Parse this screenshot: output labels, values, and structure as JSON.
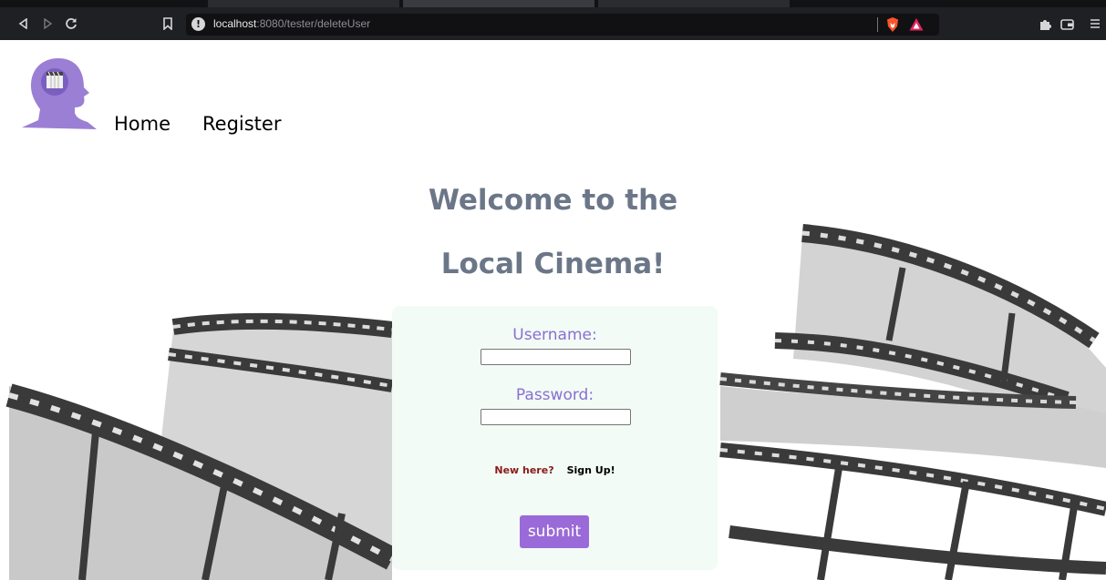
{
  "browser": {
    "url_host": "localhost",
    "url_rest": ":8080/tester/deleteUser",
    "back_icon": "back-arrow-icon",
    "forward_icon": "forward-arrow-icon",
    "reload_icon": "reload-icon",
    "bookmark_icon": "bookmark-icon",
    "info_icon": "info-icon",
    "brave_shield_icon": "brave-shield-icon",
    "brave_rewards_icon": "brave-rewards-icon",
    "extensions_icon": "puzzle-icon",
    "wallet_icon": "wallet-icon",
    "menu_icon": "hamburger-icon"
  },
  "nav": {
    "home_label": "Home",
    "register_label": "Register"
  },
  "hero": {
    "line1": "Welcome to the",
    "line2": "Local Cinema!"
  },
  "login": {
    "username_label": "Username:",
    "username_value": "",
    "password_label": "Password:",
    "password_value": "",
    "new_here_text": "New here?",
    "signup_label": "Sign Up!",
    "submit_label": "submit"
  },
  "colors": {
    "heading": "#6b7788",
    "label": "#8a6fd3",
    "submit_bg": "#9a6ad8",
    "card_bg": "#f2fbf5",
    "new_here": "#8b1a1a"
  }
}
